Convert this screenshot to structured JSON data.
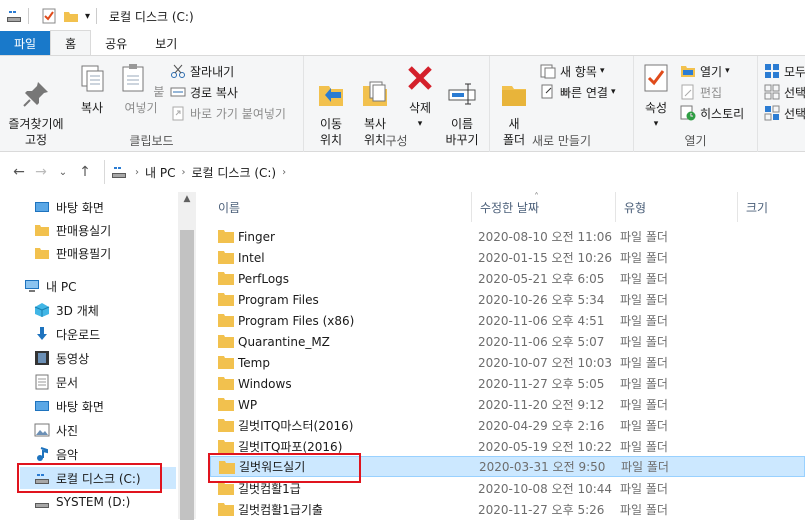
{
  "window": {
    "title": "로컬 디스크 (C:)"
  },
  "tabs": [
    {
      "label": "파일"
    },
    {
      "label": "홈"
    },
    {
      "label": "공유"
    },
    {
      "label": "보기"
    }
  ],
  "ribbon": {
    "clipboard": {
      "label": "클립보드",
      "pin_label": "즐겨찾기에\n고정",
      "copy_label": "복사",
      "paste_label": "붙여넣기",
      "cut_label": "잘라내기",
      "copy_path_label": "경로 복사",
      "paste_shortcut_label": "바로 가기 붙여넣기"
    },
    "organize": {
      "label": "구성",
      "move_label": "이동\n위치",
      "copyto_label": "복사\n위치",
      "delete_label": "삭제",
      "rename_label": "이름\n바꾸기"
    },
    "new": {
      "label": "새로 만들기",
      "new_folder_label": "새\n폴더",
      "new_item_label": "새 항목",
      "easy_access_label": "빠른 연결"
    },
    "open": {
      "label": "열기",
      "properties_label": "속성",
      "open_label": "열기",
      "edit_label": "편집",
      "history_label": "히스토리"
    },
    "select": {
      "select_all_label": "모두",
      "select_none_label": "선택",
      "invert_label": "선택"
    }
  },
  "address": {
    "crumbs": [
      "내 PC",
      "로컬 디스크 (C:)"
    ]
  },
  "nav": {
    "items": [
      {
        "label": "바탕 화면",
        "icon": "desktop-icon"
      },
      {
        "label": "판매용실기",
        "icon": "folder-icon"
      },
      {
        "label": "판매용필기",
        "icon": "folder-icon"
      },
      {
        "label": "내 PC",
        "icon": "pc-icon"
      },
      {
        "label": "3D 개체",
        "icon": "3d-objects-icon"
      },
      {
        "label": "다운로드",
        "icon": "download-icon"
      },
      {
        "label": "동영상",
        "icon": "video-icon"
      },
      {
        "label": "문서",
        "icon": "document-icon"
      },
      {
        "label": "바탕 화면",
        "icon": "desktop-icon"
      },
      {
        "label": "사진",
        "icon": "pictures-icon"
      },
      {
        "label": "음악",
        "icon": "music-icon"
      },
      {
        "label": "로컬 디스크 (C:)",
        "icon": "drive-icon"
      },
      {
        "label": "SYSTEM (D:)",
        "icon": "drive-icon"
      }
    ]
  },
  "columns": {
    "name": "이름",
    "date": "수정한 날짜",
    "type": "유형",
    "size": "크기"
  },
  "files": [
    {
      "name": "Finger",
      "date": "2020-08-10 오전 11:06",
      "type": "파일 폴더"
    },
    {
      "name": "Intel",
      "date": "2020-01-15 오전 10:26",
      "type": "파일 폴더"
    },
    {
      "name": "PerfLogs",
      "date": "2020-05-21 오후 6:05",
      "type": "파일 폴더"
    },
    {
      "name": "Program Files",
      "date": "2020-10-26 오후 5:34",
      "type": "파일 폴더"
    },
    {
      "name": "Program Files (x86)",
      "date": "2020-11-06 오후 4:51",
      "type": "파일 폴더"
    },
    {
      "name": "Quarantine_MZ",
      "date": "2020-11-06 오후 5:07",
      "type": "파일 폴더"
    },
    {
      "name": "Temp",
      "date": "2020-10-07 오전 10:03",
      "type": "파일 폴더"
    },
    {
      "name": "Windows",
      "date": "2020-11-27 오후 5:05",
      "type": "파일 폴더"
    },
    {
      "name": "WP",
      "date": "2020-11-20 오전 9:12",
      "type": "파일 폴더"
    },
    {
      "name": "길벗ITQ마스터(2016)",
      "date": "2020-04-29 오후 2:16",
      "type": "파일 폴더"
    },
    {
      "name": "길벗ITQ파포(2016)",
      "date": "2020-05-19 오전 10:22",
      "type": "파일 폴더"
    },
    {
      "name": "길벗워드실기",
      "date": "2020-03-31 오전 9:50",
      "type": "파일 폴더"
    },
    {
      "name": "길벗컴활1급",
      "date": "2020-10-08 오전 10:44",
      "type": "파일 폴더"
    },
    {
      "name": "길벗컴활1급기출",
      "date": "2020-11-27 오후 5:26",
      "type": "파일 폴더"
    }
  ],
  "colors": {
    "accent": "#1979ca",
    "selection": "#cce8ff",
    "highlight_box": "#e0141e",
    "folder": "#f2c14e"
  }
}
